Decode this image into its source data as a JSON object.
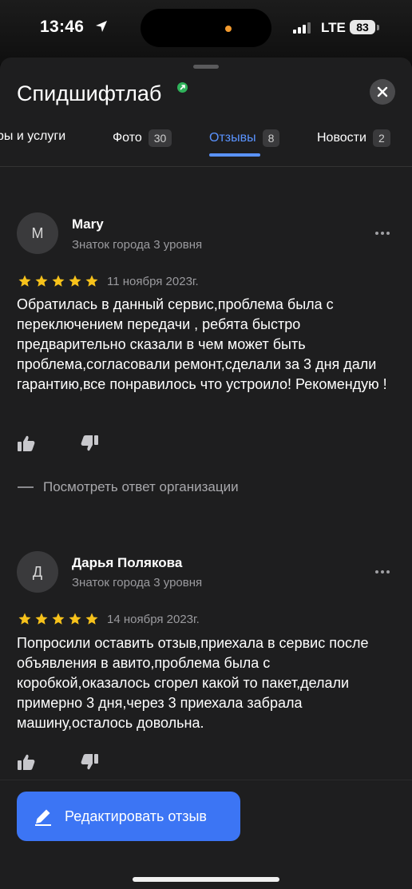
{
  "status_bar": {
    "time": "13:46",
    "network": "LTE",
    "battery": "83"
  },
  "header": {
    "title": "Спидшифтлаб",
    "close_icon": "close-icon",
    "accent": "#5a93ff"
  },
  "tabs": [
    {
      "label": "ры и услуги",
      "count": ""
    },
    {
      "label": "Фото",
      "count": "30"
    },
    {
      "label": "Отзывы",
      "count": "8"
    },
    {
      "label": "Новости",
      "count": "2"
    }
  ],
  "reviews": [
    {
      "initial": "M",
      "author": "Mary",
      "level": "Знаток города 3 уровня",
      "rating": 5,
      "date": "11 ноября 2023г.",
      "text": "Обратилась в данный сервис,проблема была с переключением передачи , ребята быстро предварительно сказали в чем может быть проблема,согласовали ремонт,сделали за 3 дня дали гарантию,все понравилось что устроило! Рекомендую !",
      "reply_link": "Посмотреть ответ организации"
    },
    {
      "initial": "Д",
      "author": "Дарья Полякова",
      "level": "Знаток города 3 уровня",
      "rating": 5,
      "date": "14 ноября 2023г.",
      "text": "Попросили оставить отзыв,приехала в сервис после объявления в авито,проблема была с коробкой,оказалось сгорел какой то пакет,делали примерно 3 дня,через 3 приехала забрала машину,осталось довольна."
    }
  ],
  "edit_button": {
    "label": "Редактировать отзыв",
    "color": "#3c75f4"
  },
  "star_color": "#f7c21b"
}
